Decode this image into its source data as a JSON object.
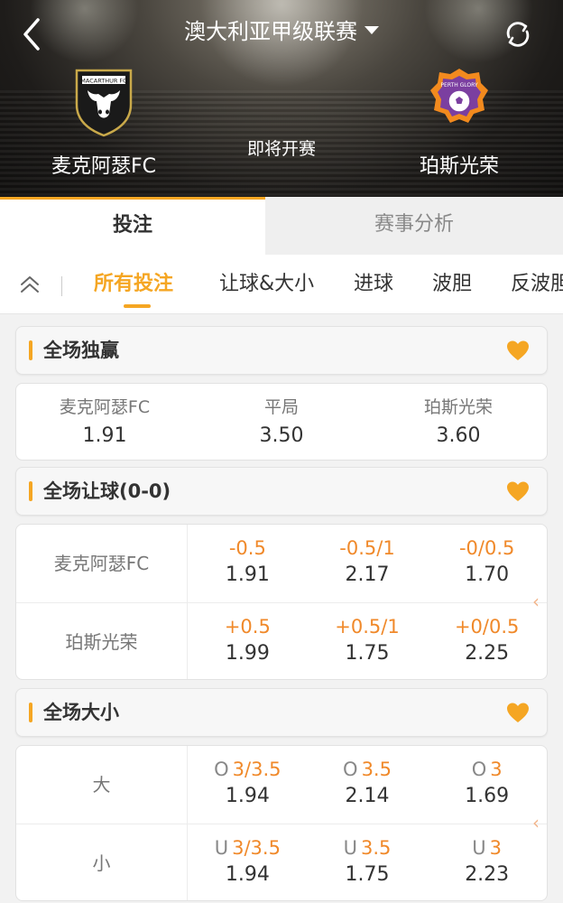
{
  "header": {
    "league_title": "澳大利亚甲级联赛",
    "match_status": "即将开赛",
    "home_team": {
      "name": "麦克阿瑟FC",
      "logo_text": "MACARTHUR FC"
    },
    "away_team": {
      "name": "珀斯光荣",
      "logo_text": "PERTH GLORY"
    }
  },
  "main_tabs": [
    {
      "label": "投注",
      "active": true
    },
    {
      "label": "赛事分析",
      "active": false
    }
  ],
  "filter_tabs": [
    {
      "label": "所有投注",
      "active": true
    },
    {
      "label": "让球&大小",
      "active": false
    },
    {
      "label": "进球",
      "active": false
    },
    {
      "label": "波胆",
      "active": false
    },
    {
      "label": "反波胆",
      "active": false
    }
  ],
  "sections": {
    "full_time_result": {
      "title": "全场独赢",
      "options": [
        {
          "label": "麦克阿瑟FC",
          "odds": "1.91"
        },
        {
          "label": "平局",
          "odds": "3.50"
        },
        {
          "label": "珀斯光荣",
          "odds": "3.60"
        }
      ]
    },
    "handicap": {
      "title": "全场让球(0-0)",
      "rows": [
        {
          "label": "麦克阿瑟FC",
          "options": [
            {
              "line": "-0.5",
              "odds": "1.91"
            },
            {
              "line": "-0.5/1",
              "odds": "2.17"
            },
            {
              "line": "-0/0.5",
              "odds": "1.70"
            }
          ]
        },
        {
          "label": "珀斯光荣",
          "options": [
            {
              "line": "+0.5",
              "odds": "1.99"
            },
            {
              "line": "+0.5/1",
              "odds": "1.75"
            },
            {
              "line": "+0/0.5",
              "odds": "2.25"
            }
          ]
        }
      ]
    },
    "over_under": {
      "title": "全场大小",
      "rows": [
        {
          "label": "大",
          "options": [
            {
              "prefix": "O",
              "line": "3/3.5",
              "odds": "1.94"
            },
            {
              "prefix": "O",
              "line": "3.5",
              "odds": "2.14"
            },
            {
              "prefix": "O",
              "line": "3",
              "odds": "1.69"
            }
          ]
        },
        {
          "label": "小",
          "options": [
            {
              "prefix": "U",
              "line": "3/3.5",
              "odds": "1.94"
            },
            {
              "prefix": "U",
              "line": "3.5",
              "odds": "1.75"
            },
            {
              "prefix": "U",
              "line": "3",
              "odds": "2.23"
            }
          ]
        }
      ]
    }
  },
  "icons": {
    "back": "chevron-left-icon",
    "dropdown": "caret-down-icon",
    "refresh": "refresh-icon",
    "collapse": "double-chevron-up-icon",
    "favorite": "heart-icon",
    "scroll_hint": "chevron-left-icon"
  },
  "colors": {
    "accent": "#f5a623",
    "odds_line": "#f0892a",
    "favorite": "#f5a623"
  }
}
